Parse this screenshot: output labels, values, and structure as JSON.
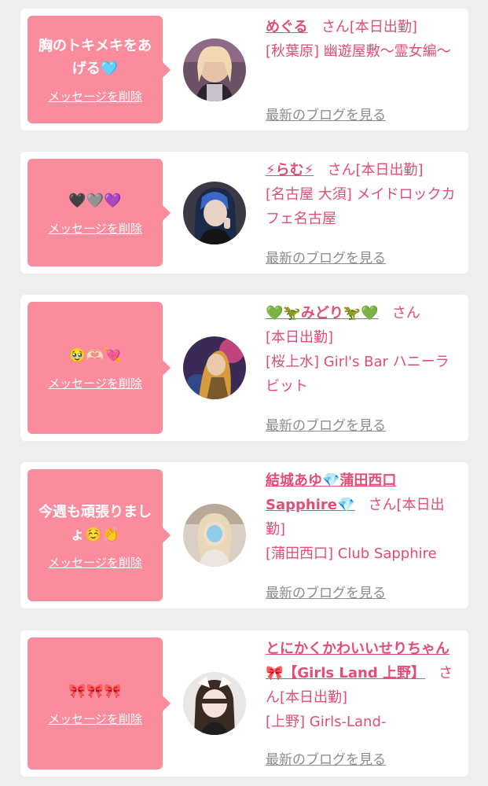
{
  "common": {
    "delete_label": "メッセージを削除",
    "blog_label": "最新のブログを見る",
    "san": "さん"
  },
  "cards": [
    {
      "message": "胸のトキメキをあげる🩵",
      "name": "めぐる",
      "status": "[本日出勤]",
      "shop": "[秋葉原] 幽遊屋敷〜霊女編〜"
    },
    {
      "message": "🖤🩶💜",
      "name": "⚡らむ⚡",
      "status": "[本日出勤]",
      "shop": "[名古屋 大須] メイドロックカフェ名古屋"
    },
    {
      "message": "🥹🫶🏻💘",
      "name": "💚🦖みどり🦖💚",
      "status": "[本日出勤]",
      "shop": "[桜上水] Girl's Bar ハニーラビット"
    },
    {
      "message": "今週も頑張りましょ☺️👏",
      "name": "結城あゆ💎蒲田西口Sapphire💎",
      "status": "[本日出勤]",
      "shop": "[蒲田西口] Club Sapphire"
    },
    {
      "message": "🎀🎀🎀",
      "name": "とにかくかわいいせりちゃん🎀【Girls Land 上野】",
      "status": "[本日出勤]",
      "shop": "[上野] Girls-Land-"
    }
  ]
}
